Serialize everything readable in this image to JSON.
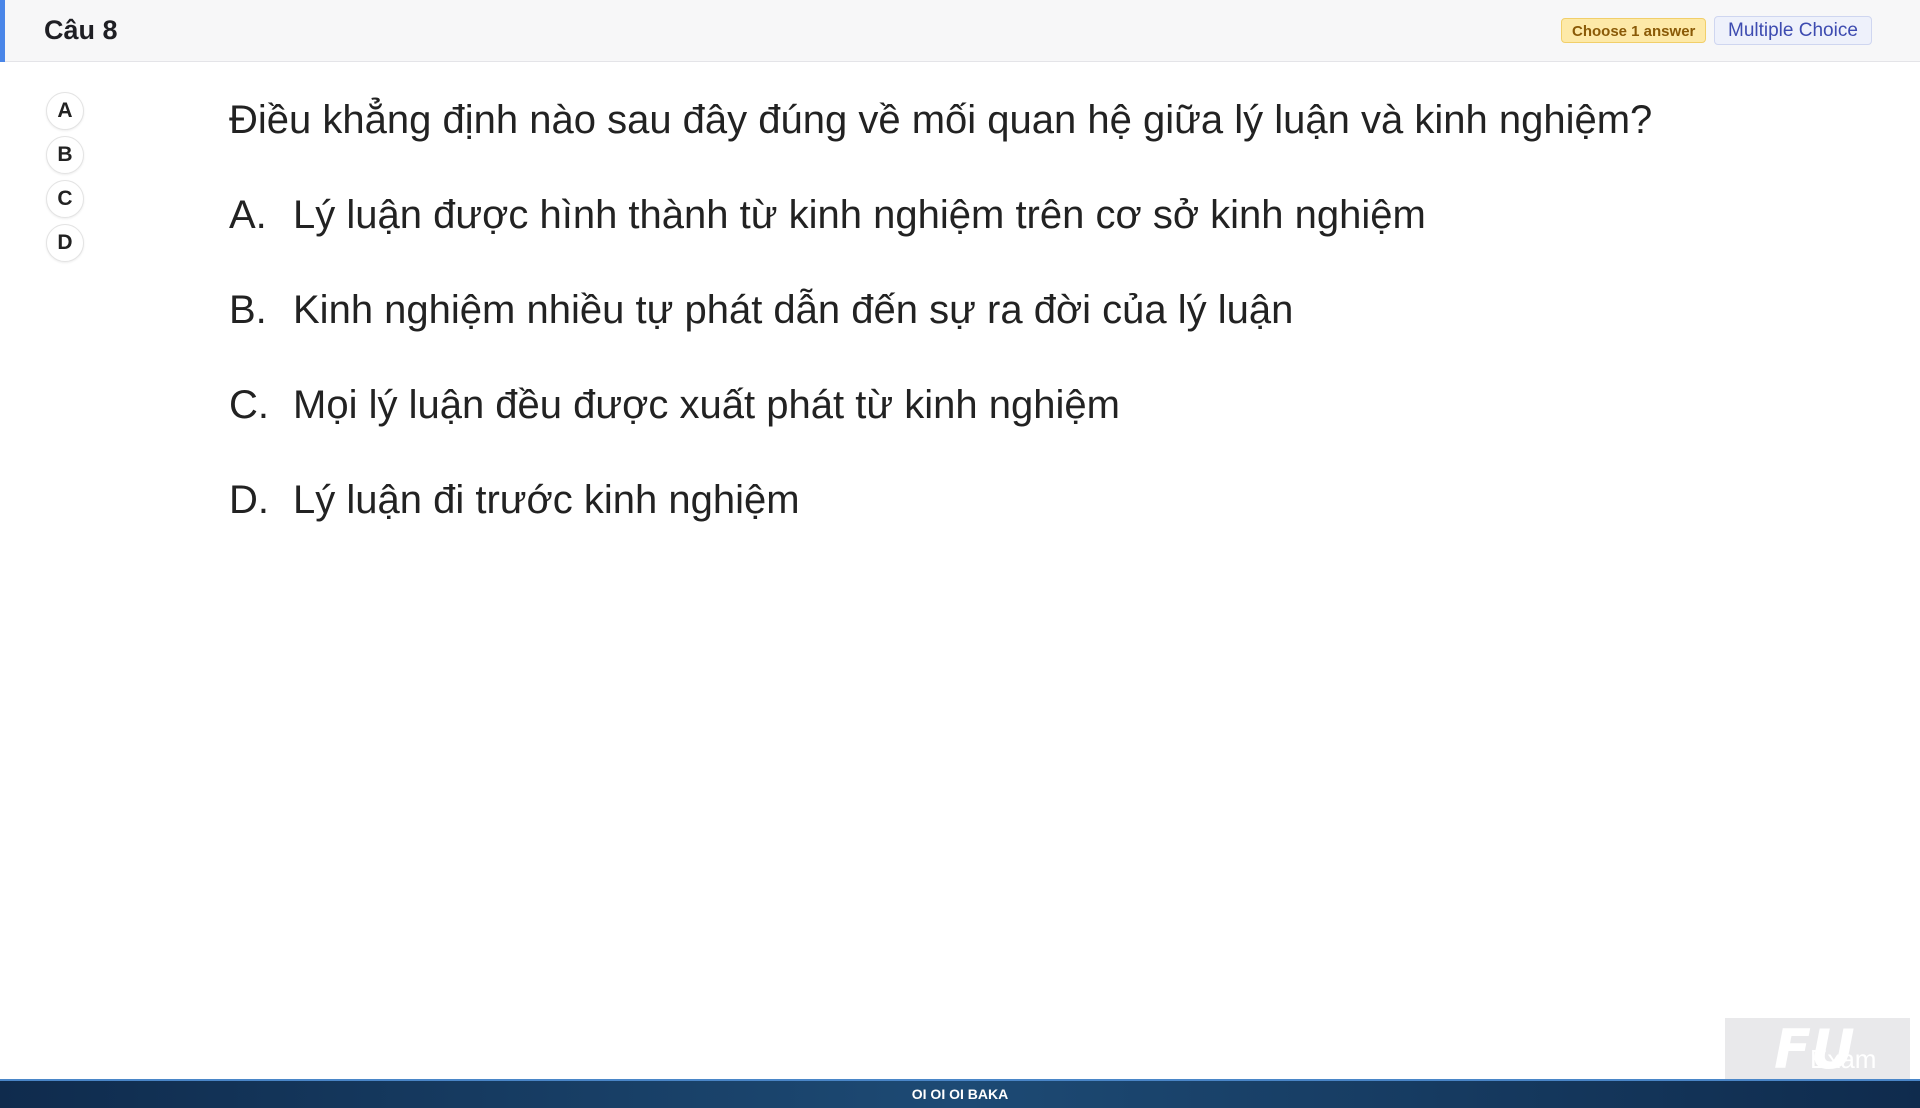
{
  "header": {
    "title": "Câu 8",
    "badge_instruction": "Choose 1 answer",
    "badge_type": "Multiple Choice"
  },
  "answers": [
    {
      "label": "A"
    },
    {
      "label": "B"
    },
    {
      "label": "C"
    },
    {
      "label": "D"
    }
  ],
  "question": {
    "text": "Điều khẳng định nào sau đây đúng về mối quan hệ giữa lý luận và kinh nghiệm?",
    "options": [
      {
        "letter": "A.",
        "text": "Lý luận được hình thành từ kinh nghiệm trên cơ sở kinh nghiệm"
      },
      {
        "letter": "B.",
        "text": "Kinh nghiệm nhiều tự phát dẫn đến sự ra đời của lý luận"
      },
      {
        "letter": "C.",
        "text": "Mọi lý luận đều được xuất phát từ kinh nghiệm"
      },
      {
        "letter": "D.",
        "text": "Lý luận đi trước kinh nghiệm"
      }
    ]
  },
  "footer": {
    "text": "OI OI OI BAKA"
  },
  "logo": {
    "mark": "FU",
    "text": "Exam"
  },
  "colors": {
    "accent": "#4a86e8",
    "footer": "#1d4a74",
    "badge_choose": "#fde9a8",
    "badge_type": "#eef1fb"
  }
}
